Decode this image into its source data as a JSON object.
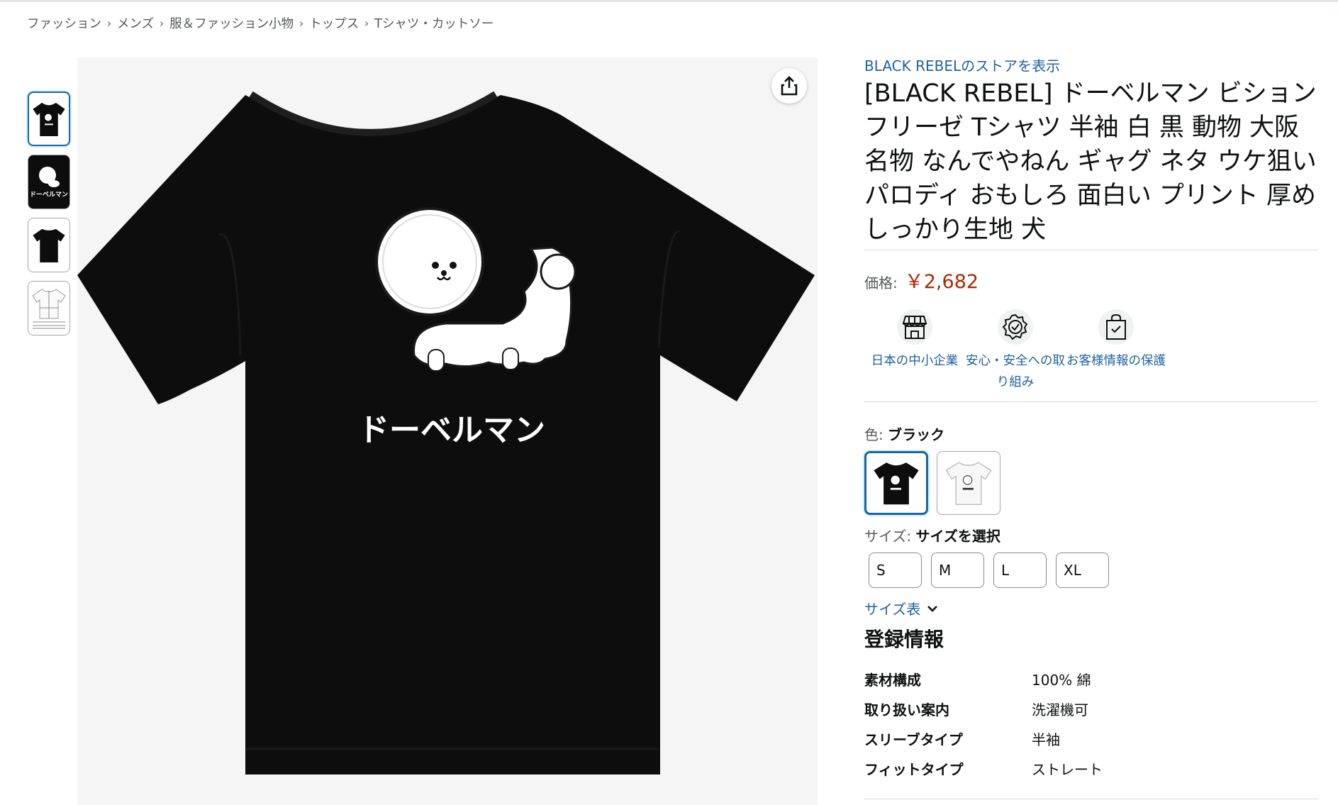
{
  "breadcrumb": [
    "ファッション",
    "メンズ",
    "服＆ファッション小物",
    "トップス",
    "Tシャツ・カットソー"
  ],
  "breadcrumb_separator": "›",
  "image": {
    "print_text": "ドーベルマン"
  },
  "thumbnails": [
    {
      "alt": "black-tshirt-front"
    },
    {
      "alt": "design-closeup",
      "text": "ドーベルマン"
    },
    {
      "alt": "black-tshirt-back"
    },
    {
      "alt": "size-chart"
    }
  ],
  "product": {
    "store_link": "BLACK REBELのストアを表示",
    "title": "[BLACK REBEL] ドーベルマン ビションフリーゼ Tシャツ 半袖 白 黒 動物 大阪名物 なんでやねん ギャグ ネタ ウケ狙い パロディ おもしろ 面白い プリント 厚め しっかり生地 犬",
    "price_label": "価格:",
    "price": "￥2,682"
  },
  "badges": [
    {
      "label": "日本の中小企業",
      "icon": "store-icon"
    },
    {
      "label": "安心・安全への取り組み",
      "icon": "shield-check-icon"
    },
    {
      "label": "お客様情報の保護",
      "icon": "secure-bag-icon"
    }
  ],
  "color": {
    "label": "色:",
    "selected": "ブラック",
    "options": [
      "ブラック",
      "ホワイト"
    ]
  },
  "size": {
    "label": "サイズ:",
    "selected": "サイズを選択",
    "options": [
      "S",
      "M",
      "L",
      "XL"
    ],
    "chart_link": "サイズ表"
  },
  "registration": {
    "title": "登録情報",
    "rows": [
      {
        "key": "素材構成",
        "value": "100% 綿"
      },
      {
        "key": "取り扱い案内",
        "value": "洗濯機可"
      },
      {
        "key": "スリーブタイプ",
        "value": "半袖"
      },
      {
        "key": "フィットタイプ",
        "value": "ストレート"
      }
    ]
  },
  "colors": {
    "link": "#2162a1",
    "price": "#b12704",
    "shirt_black": "#0d0d0d",
    "selected_border": "#2162a1"
  }
}
